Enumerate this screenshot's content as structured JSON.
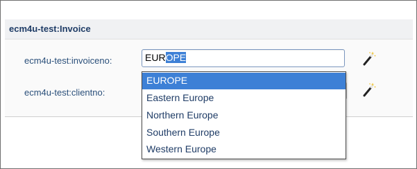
{
  "panel": {
    "title": "ecm4u-test:Invoice"
  },
  "fields": {
    "invoiceno": {
      "label": "ecm4u-test:invoiceno:",
      "typed": "EUR",
      "autocomplete_selected": "OPE"
    },
    "clientno": {
      "label": "ecm4u-test:clientno:",
      "value": ""
    }
  },
  "dropdown": {
    "options": [
      "EUROPE",
      "Eastern Europe",
      "Northern Europe",
      "Southern Europe",
      "Western Europe"
    ],
    "highlighted": "EUROPE"
  },
  "icons": {
    "invoiceno_action": "magic-wand-icon",
    "clientno_action": "magic-wand-icon"
  },
  "colors": {
    "highlight": "#3d80d6",
    "label": "#2a4f7a",
    "title": "#1f3c66"
  }
}
